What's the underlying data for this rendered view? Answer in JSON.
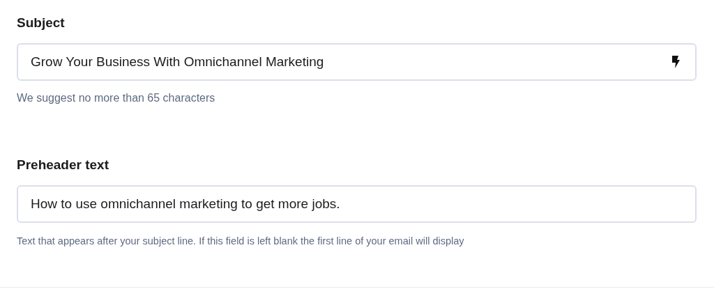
{
  "fields": [
    {
      "label": "Subject",
      "value": "Grow Your Business With Omnichannel Marketing",
      "hint": "We suggest no more than 65 characters",
      "kind": "snippet"
    },
    {
      "label": "Preheader text",
      "value": "How to use omnichannel marketing to get more jobs.",
      "hint": "Text that appears after your subject line. If this field is left blank the first line of your email will display",
      "kind": "plain"
    }
  ]
}
